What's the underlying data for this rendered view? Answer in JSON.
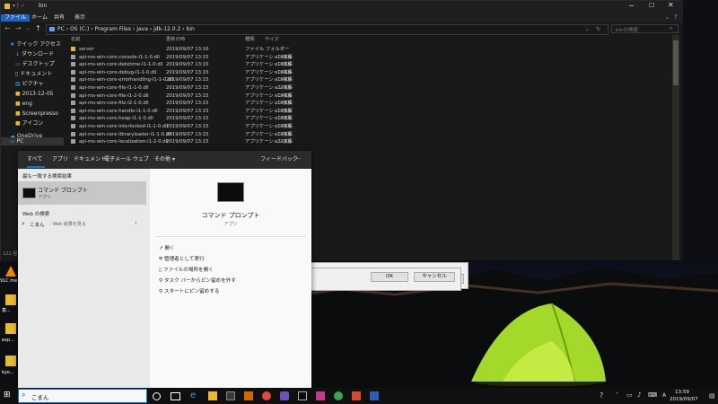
{
  "explorer": {
    "title": "bin",
    "ribbon_tabs": [
      "ファイル",
      "ホーム",
      "共有",
      "表示"
    ],
    "breadcrumb": [
      "PC",
      "OS (C:)",
      "Program Files",
      "Java",
      "jdk-12.0.2",
      "bin"
    ],
    "search_placeholder": "binの検索",
    "columns": [
      "名前",
      "更新日時",
      "種類",
      "サイズ"
    ],
    "files": [
      {
        "name": "server",
        "date": "2019/09/07 13:16",
        "type": "ファイル フォルダー",
        "size": ""
      },
      {
        "name": "api-ms-win-core-console-l1-1-0.dll",
        "date": "2019/09/07 13:15",
        "type": "アプリケーション拡張",
        "size": "19 KB"
      },
      {
        "name": "api-ms-win-core-datetime-l1-1-0.dll",
        "date": "2019/09/07 13:15",
        "type": "アプリケーション拡張",
        "size": "19 KB"
      },
      {
        "name": "api-ms-win-core-debug-l1-1-0.dll",
        "date": "2019/09/07 13:15",
        "type": "アプリケーション拡張",
        "size": "19 KB"
      },
      {
        "name": "api-ms-win-core-errorhandling-l1-1-0.dll",
        "date": "2019/09/07 13:15",
        "type": "アプリケーション拡張",
        "size": "19 KB"
      },
      {
        "name": "api-ms-win-core-file-l1-1-0.dll",
        "date": "2019/09/07 13:15",
        "type": "アプリケーション拡張",
        "size": "22 KB"
      },
      {
        "name": "api-ms-win-core-file-l1-2-0.dll",
        "date": "2019/09/07 13:15",
        "type": "アプリケーション拡張",
        "size": "19 KB"
      },
      {
        "name": "api-ms-win-core-file-l2-1-0.dll",
        "date": "2019/09/07 13:15",
        "type": "アプリケーション拡張",
        "size": "19 KB"
      },
      {
        "name": "api-ms-win-core-handle-l1-1-0.dll",
        "date": "2019/09/07 13:15",
        "type": "アプリケーション拡張",
        "size": "19 KB"
      },
      {
        "name": "api-ms-win-core-heap-l1-1-0.dll",
        "date": "2019/09/07 13:15",
        "type": "アプリケーション拡張",
        "size": "19 KB"
      },
      {
        "name": "api-ms-win-core-interlocked-l1-1-0.dll",
        "date": "2019/09/07 13:15",
        "type": "アプリケーション拡張",
        "size": "19 KB"
      },
      {
        "name": "api-ms-win-core-libraryloader-l1-1-0.dll",
        "date": "2019/09/07 13:15",
        "type": "アプリケーション拡張",
        "size": "19 KB"
      },
      {
        "name": "api-ms-win-core-localization-l1-2-0.dll",
        "date": "2019/09/07 13:15",
        "type": "アプリケーション拡張",
        "size": "21 KB"
      }
    ],
    "nav": [
      {
        "label": "クイック アクセス",
        "icon": "star-icon"
      },
      {
        "label": "ダウンロード",
        "icon": "download-icon"
      },
      {
        "label": "デスクトップ",
        "icon": "desktop-icon"
      },
      {
        "label": "ドキュメント",
        "icon": "document-icon"
      },
      {
        "label": "ピクチャ",
        "icon": "picture-icon"
      },
      {
        "label": "2013-12-05",
        "icon": "folder-icon"
      },
      {
        "label": "eng",
        "icon": "folder-icon"
      },
      {
        "label": "Screenpresso",
        "icon": "folder-icon"
      },
      {
        "label": "アイコン",
        "icon": "folder-icon"
      },
      {
        "label": "OneDrive",
        "icon": "cloud-icon"
      },
      {
        "label": "PC",
        "icon": "pc-icon"
      }
    ],
    "status_count": "122 個"
  },
  "start_panel": {
    "filter_tabs": [
      "すべて",
      "アプリ",
      "ドキュメント",
      "電子メール",
      "ウェブ",
      "その他"
    ],
    "feedback_label": "フィードバック",
    "more_label": "···",
    "best_match_header": "最も一致する検索結果",
    "best_match_name": "コマンド プロンプト",
    "best_match_type": "アプリ",
    "web_header": "Web の検索",
    "web_query": "こまん",
    "web_hint": "- Web 結果を見る",
    "detail_name": "コマンド プロンプト",
    "detail_type": "アプリ",
    "actions": [
      {
        "label": "開く",
        "icon": "open-icon"
      },
      {
        "label": "管理者として実行",
        "icon": "shield-icon"
      },
      {
        "label": "ファイルの場所を開く",
        "icon": "folder-icon"
      },
      {
        "label": "タスク バーからピン留めを外す",
        "icon": "unpin-icon"
      },
      {
        "label": "スタートにピン留めする",
        "icon": "pin-icon"
      }
    ]
  },
  "dialogs": {
    "ok_label": "OK",
    "cancel_label": "キャンセル"
  },
  "desktop_icons": [
    {
      "label": "VLC me...",
      "icon": "vlc-icon"
    },
    {
      "label": "富...",
      "icon": "folder-icon"
    },
    {
      "label": "exp...",
      "icon": "folder-icon"
    },
    {
      "label": "kyo...",
      "icon": "folder-icon"
    }
  ],
  "taskbar": {
    "search_text": "こまん",
    "time": "13:59",
    "date": "2019/09/07",
    "ime": "A"
  }
}
